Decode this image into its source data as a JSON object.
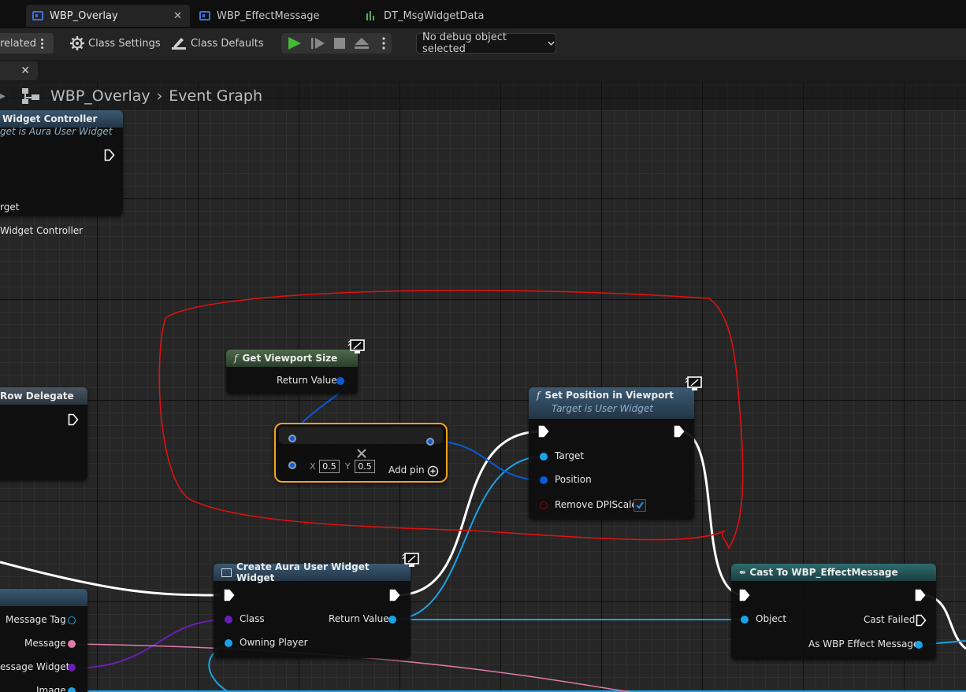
{
  "tabs": [
    {
      "label": "WBP_Overlay",
      "active": true
    },
    {
      "label": "WBP_EffectMessage",
      "active": false
    },
    {
      "label": "DT_MsgWidgetData",
      "active": false
    }
  ],
  "toolbar": {
    "related_label": "related",
    "class_settings": "Class Settings",
    "class_defaults": "Class Defaults",
    "debug_select": "No debug object selected"
  },
  "breadcrumb": {
    "asset": "WBP_Overlay",
    "graph": "Event Graph"
  },
  "nodes": {
    "set_widget_controller": {
      "title": "Widget Controller",
      "subtitle": "get is Aura User Widget",
      "pin_target": "rget",
      "pin_controller": "Widget Controller"
    },
    "row_delegate": {
      "title": "Row Delegate"
    },
    "get_viewport_size": {
      "title": "Get Viewport Size",
      "return_value": "Return Value"
    },
    "multiply": {
      "x_label": "X",
      "x_value": "0.5",
      "y_label": "Y",
      "y_value": "0.5",
      "add_pin": "Add pin"
    },
    "set_position": {
      "title": "Set Position in Viewport",
      "subtitle": "Target is User Widget",
      "pin_target": "Target",
      "pin_position": "Position",
      "pin_remove_dpi": "Remove DPIScale",
      "remove_dpi_checked": true
    },
    "create_widget": {
      "title": "Create Aura User Widget Widget",
      "pin_class": "Class",
      "pin_owning_player": "Owning Player",
      "return_value": "Return Value"
    },
    "cast_node": {
      "title": "Cast To WBP_EffectMessage",
      "pin_object": "Object",
      "cast_failed": "Cast Failed",
      "as_wbp": "As WBP Effect Message"
    },
    "break_row": {
      "pin_message_tag": "Message Tag",
      "pin_message": "Message",
      "pin_message_widget": "essage Widget",
      "pin_image": "Image"
    }
  },
  "colors": {
    "exec": "#ffffff",
    "object_pin": "#1aa3e8",
    "struct_pin": "#0c5ad6",
    "class_pin": "#6a1fb4",
    "text_pin": "#e07aa8",
    "bool_pin": "#8a0000",
    "selection": "#f2a51c",
    "annotation": "#e01010"
  }
}
